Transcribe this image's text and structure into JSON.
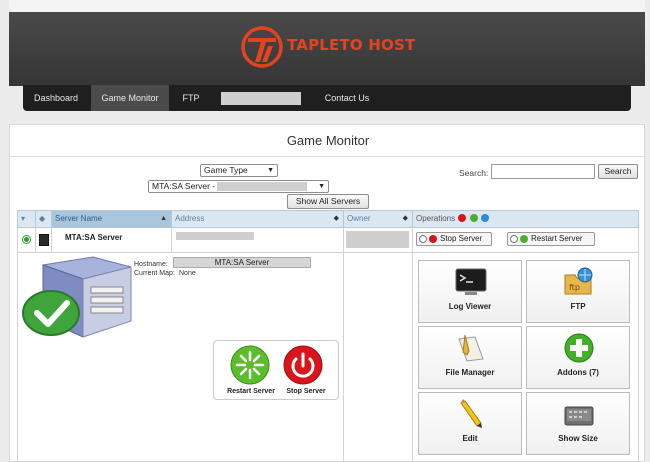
{
  "brand": {
    "name": "TAPLETO HOST",
    "accent": "#e5431f"
  },
  "nav": {
    "items": [
      {
        "label": "Dashboard"
      },
      {
        "label": "Game Monitor",
        "active": true
      },
      {
        "label": "FTP"
      },
      {
        "label": "Contact Us"
      }
    ]
  },
  "page": {
    "title": "Game Monitor"
  },
  "filters": {
    "game_type": "Game Type",
    "server_select": "MTA:SA Server -",
    "show_all": "Show All Servers",
    "search_label": "Search:",
    "search_value": "",
    "search_button": "Search"
  },
  "table": {
    "headers": {
      "server_name": "Server Name",
      "address": "Address",
      "owner": "Owner",
      "operations": "Operations"
    },
    "row": {
      "server_name": "MTA:SA Server",
      "status": "online",
      "stop_button": "Stop Server",
      "restart_button": "Restart Server"
    }
  },
  "details": {
    "hostname_label": "Hostname:",
    "hostname_value": "MTA:SA Server",
    "current_map_label": "Current Map:",
    "current_map_value": "None",
    "restart_label": "Restart Server",
    "stop_label": "Stop Server"
  },
  "tiles": [
    {
      "label": "Log Viewer",
      "icon": "terminal-icon"
    },
    {
      "label": "FTP",
      "icon": "ftp-folder-icon"
    },
    {
      "label": "File Manager",
      "icon": "file-manager-icon"
    },
    {
      "label": "Addons (7)",
      "icon": "add-icon"
    },
    {
      "label": "Edit",
      "icon": "pencil-icon"
    },
    {
      "label": "Show Size",
      "icon": "hard-drive-icon"
    }
  ],
  "colors": {
    "header_bg": "#3c3c3c",
    "nav_bg": "#1f1f1f",
    "table_header": "#dbe8f2",
    "status_green": "#2aa32a",
    "stop_red": "#d9141b"
  }
}
